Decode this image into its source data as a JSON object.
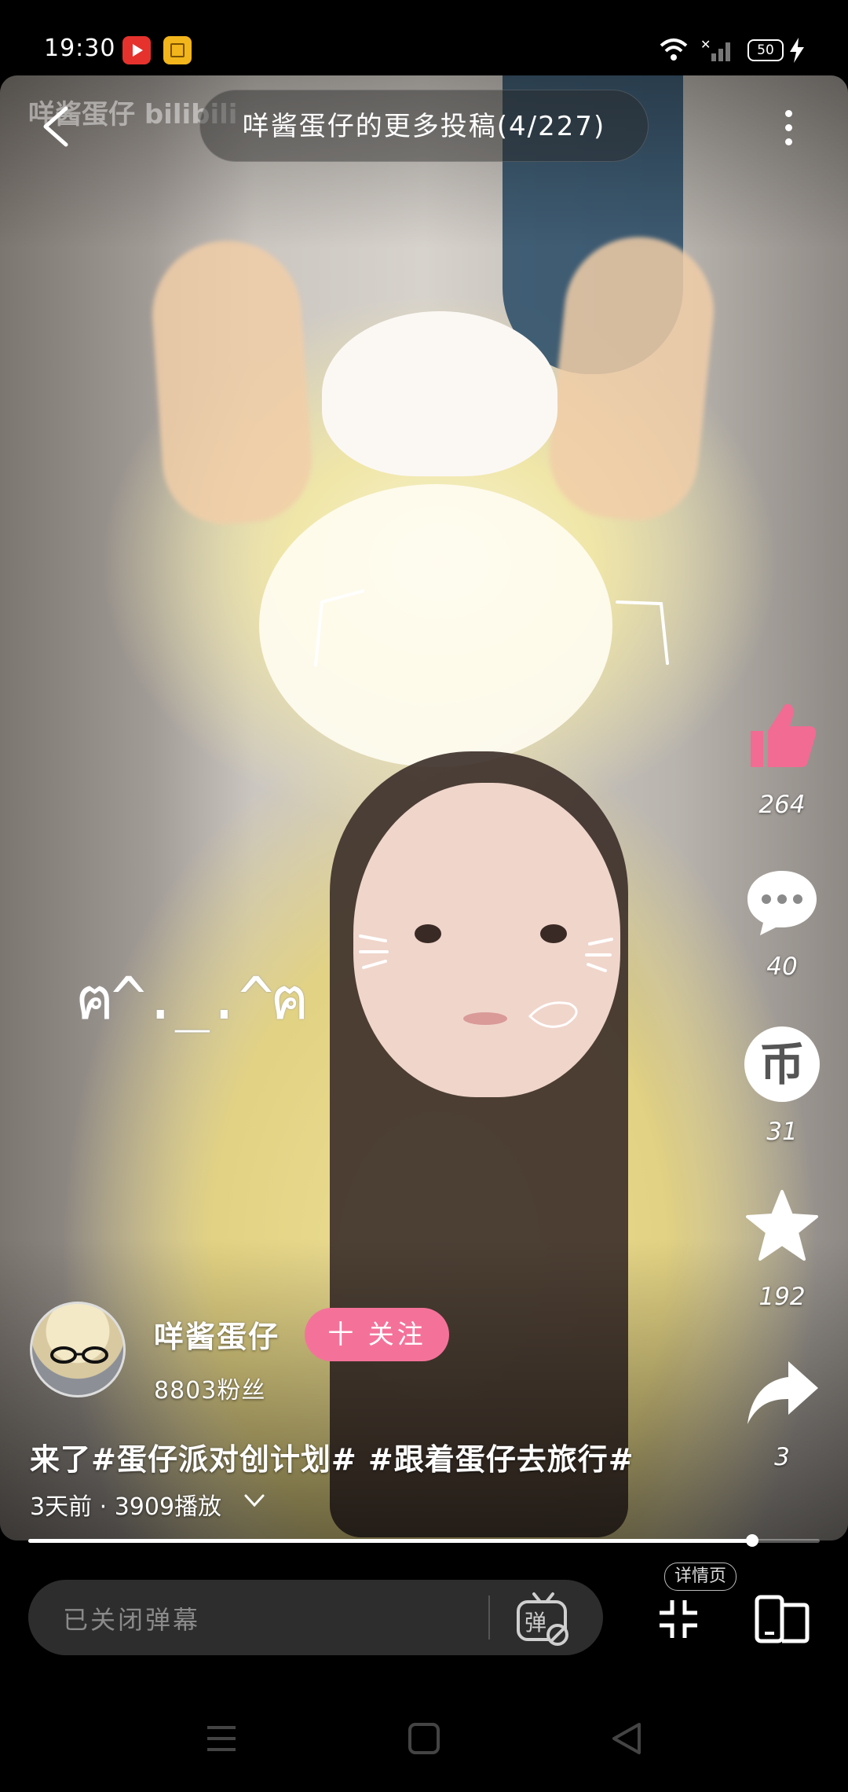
{
  "status_bar": {
    "time": "19:30",
    "battery": "50",
    "icons": [
      "video-app-icon",
      "book-app-icon",
      "wifi-icon",
      "signal-icon",
      "battery-icon",
      "charging-icon"
    ]
  },
  "video": {
    "watermark": "咩酱蛋仔 bilibili",
    "more_title": "咩酱蛋仔的更多投稿(4/227)",
    "sticker_text": "ฅ^._.^ฅ",
    "progress": 0.915
  },
  "actions": {
    "like_count": "264",
    "comment_count": "40",
    "coin_glyph": "币",
    "coin_count": "31",
    "favorite_count": "192",
    "share_count": "3"
  },
  "uploader": {
    "name": "咩酱蛋仔",
    "follow_label": "十 关注",
    "fans": "8803粉丝"
  },
  "caption": "来了#蛋仔派对创计划# #跟着蛋仔去旅行#",
  "meta": "3天前 · 3909播放",
  "bottom_bar": {
    "danmaku_placeholder": "已关闭弹幕",
    "detail_label": "详情页"
  },
  "colors": {
    "accent_pink": "#f4729a",
    "like_pink": "#f26b93"
  }
}
